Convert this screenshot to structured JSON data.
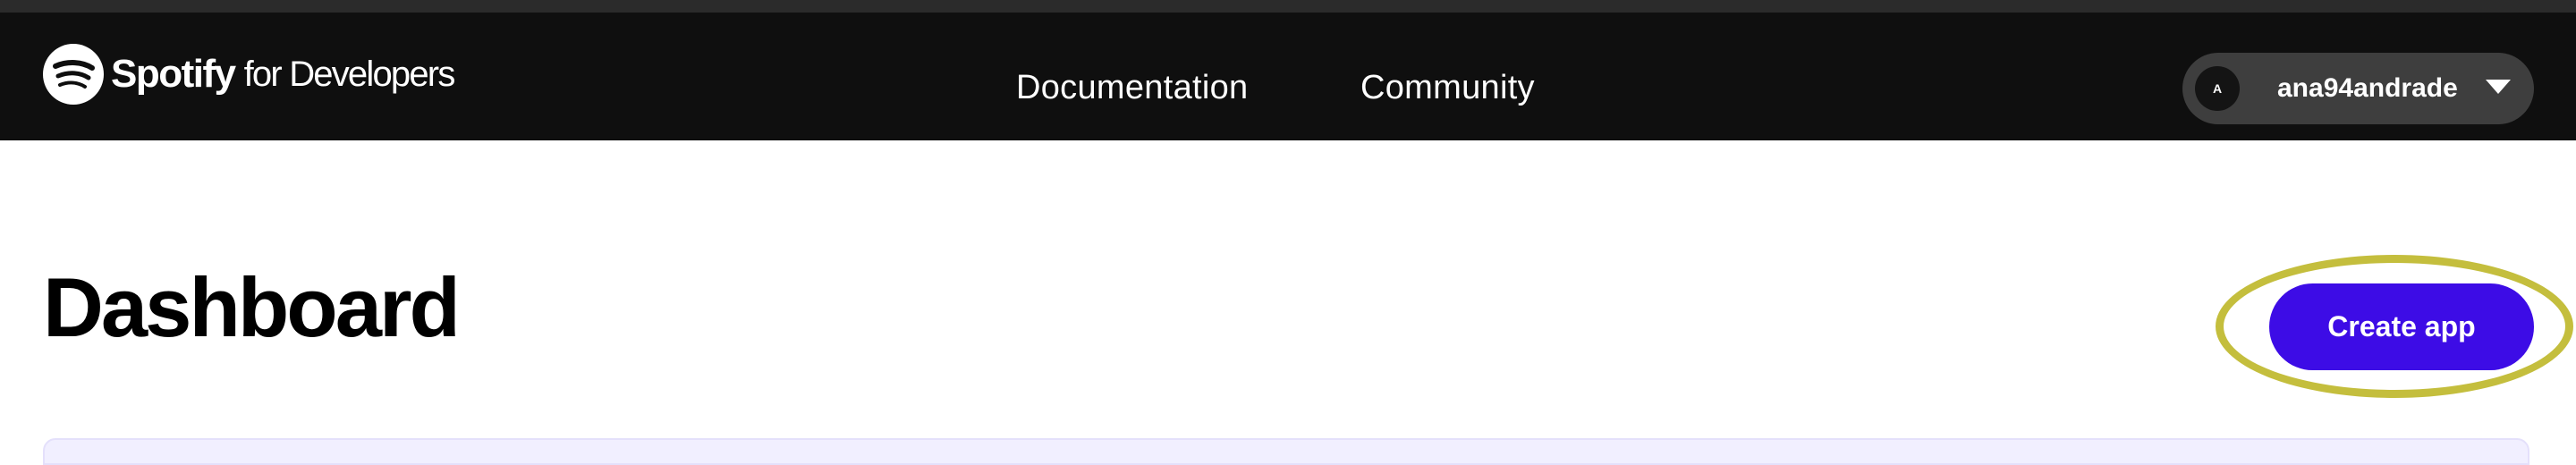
{
  "navbar": {
    "logo": {
      "brand": "Spotify",
      "suffix": "for Developers",
      "icon": "spotify-logo-icon"
    },
    "links": [
      {
        "label": "Documentation"
      },
      {
        "label": "Community"
      }
    ],
    "user": {
      "avatar_initial": "A",
      "username": "ana94andrade",
      "menu_icon": "caret-down-icon"
    }
  },
  "page": {
    "title": "Dashboard",
    "create_button_label": "Create app"
  },
  "colors": {
    "navbar_bg": "#0f0f0f",
    "accent": "#3d0ce6",
    "highlight": "#c4be3d",
    "user_pill_bg": "#3e3e3e"
  }
}
